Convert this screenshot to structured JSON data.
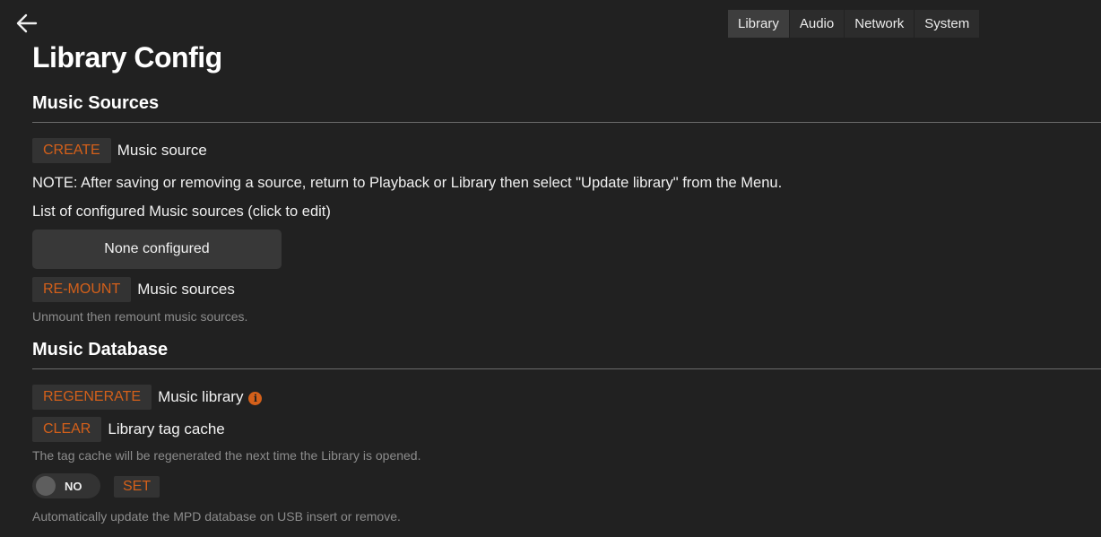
{
  "nav": {
    "back_icon": "arrow-left-icon",
    "tabs": [
      {
        "label": "Library",
        "active": true
      },
      {
        "label": "Audio",
        "active": false
      },
      {
        "label": "Network",
        "active": false
      },
      {
        "label": "System",
        "active": false
      }
    ]
  },
  "page": {
    "title": "Library Config"
  },
  "music_sources": {
    "title": "Music Sources",
    "create_button": "CREATE",
    "create_label": "Music source",
    "note": "NOTE: After saving or removing a source, return to Playback or Library then select \"Update library\" from the Menu.",
    "list_label": "List of configured Music sources (click to edit)",
    "none_configured": "None configured",
    "remount_button": "RE-MOUNT",
    "remount_label": "Music sources",
    "remount_help": "Unmount then remount music sources."
  },
  "music_database": {
    "title": "Music Database",
    "regenerate_button": "REGENERATE",
    "regenerate_label": "Music library",
    "info_icon": "info-circle-icon",
    "info_glyph": "i",
    "clear_button": "CLEAR",
    "clear_label": "Library tag cache",
    "clear_help": "The tag cache will be regenerated the next time the Library is opened.",
    "auto_update_toggle": "NO",
    "set_button": "SET",
    "auto_update_help": "Automatically update the MPD database on USB insert or remove."
  },
  "colors": {
    "background": "#212121",
    "accent": "#d4601a",
    "button_bg": "#333333"
  }
}
